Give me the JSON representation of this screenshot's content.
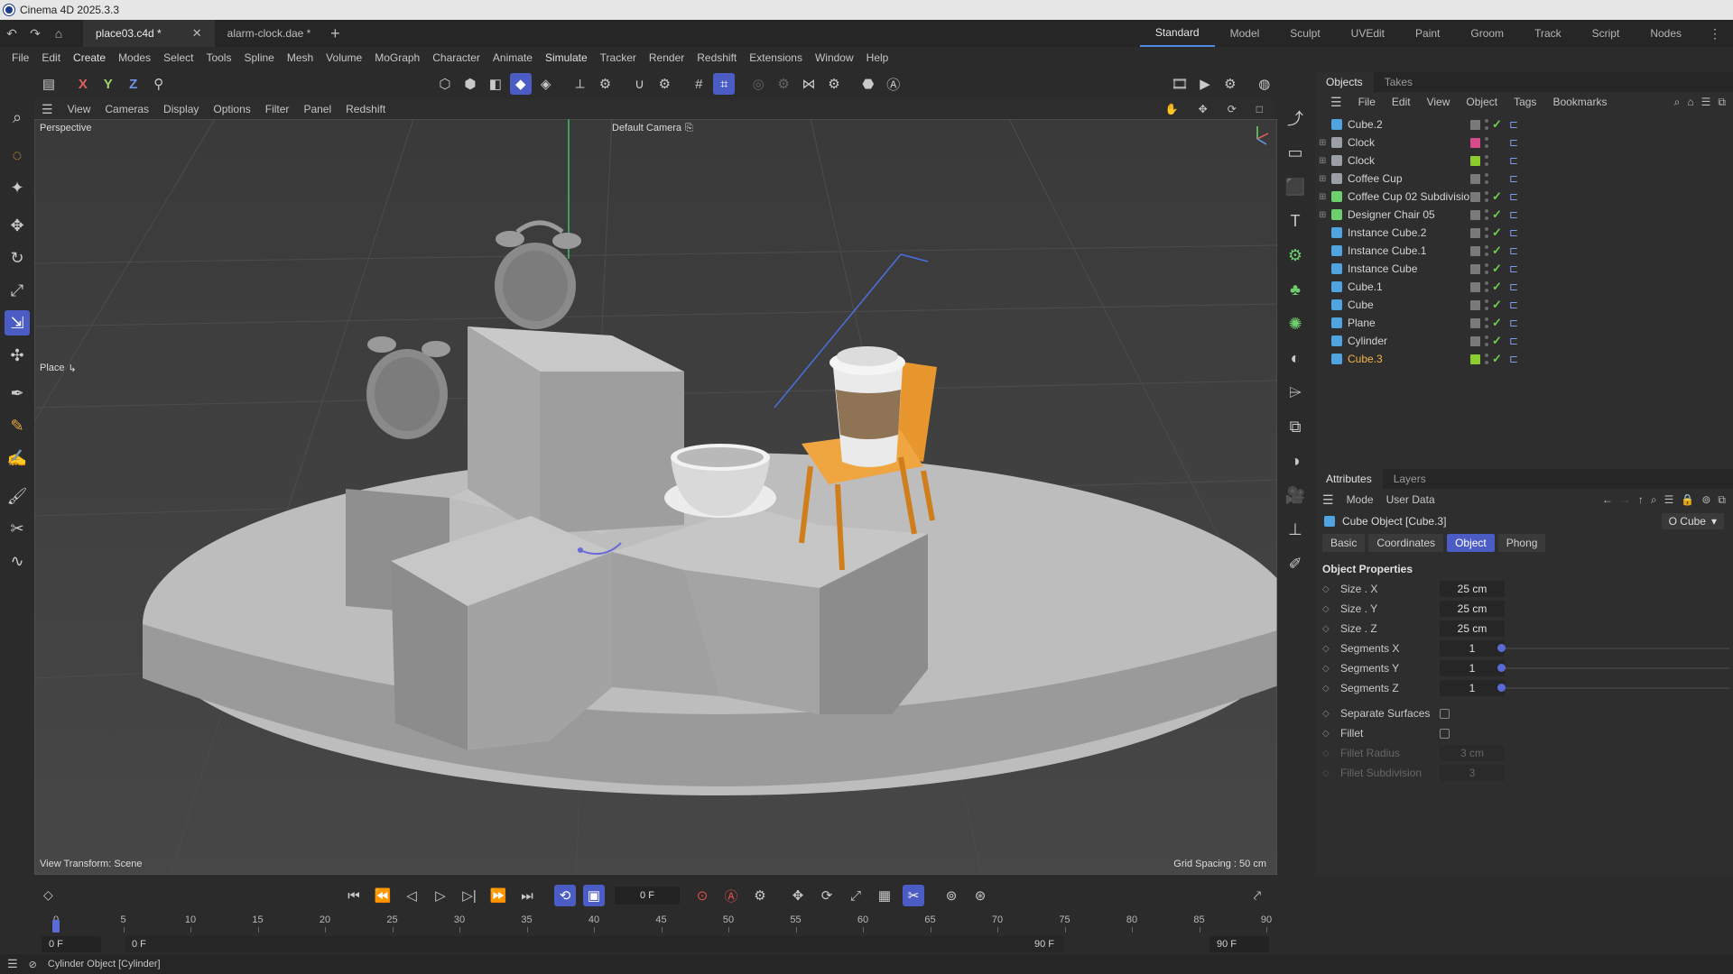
{
  "app": {
    "title": "Cinema 4D 2025.3.3"
  },
  "tabs": [
    {
      "label": "place03.c4d *",
      "active": true
    },
    {
      "label": "alarm-clock.dae *",
      "active": false
    }
  ],
  "layouts": [
    "Standard",
    "Model",
    "Sculpt",
    "UVEdit",
    "Paint",
    "Groom",
    "Track",
    "Script",
    "Nodes"
  ],
  "menus": [
    "File",
    "Edit",
    "Create",
    "Modes",
    "Select",
    "Tools",
    "Spline",
    "Mesh",
    "Volume",
    "MoGraph",
    "Character",
    "Animate",
    "Simulate",
    "Tracker",
    "Render",
    "Redshift",
    "Extensions",
    "Window",
    "Help"
  ],
  "toolbar": {
    "x": "X",
    "y": "Y",
    "z": "Z"
  },
  "viewport": {
    "menus": [
      "View",
      "Cameras",
      "Display",
      "Options",
      "Filter",
      "Panel",
      "Redshift"
    ],
    "label": "Perspective",
    "camera": "Default Camera",
    "tool_label": "Place",
    "view_transform": "View Transform: Scene",
    "grid_spacing": "Grid Spacing : 50 cm"
  },
  "objects_panel": {
    "tabs": [
      "Objects",
      "Takes"
    ],
    "menus": [
      "File",
      "Edit",
      "View",
      "Object",
      "Tags",
      "Bookmarks"
    ],
    "items": [
      {
        "name": "Cube.2",
        "swatch": "#7a7a7a",
        "check": true,
        "expand": false,
        "icon": "#4fa3e0",
        "selected": false
      },
      {
        "name": "Clock",
        "swatch": "#d84a8c",
        "check": false,
        "expand": true,
        "icon": "#9aa0a6",
        "selected": false
      },
      {
        "name": "Clock",
        "swatch": "#8ccc2e",
        "check": false,
        "expand": true,
        "icon": "#9aa0a6",
        "selected": false
      },
      {
        "name": "Coffee Cup",
        "swatch": "#7a7a7a",
        "check": false,
        "expand": true,
        "icon": "#9aa0a6",
        "selected": false
      },
      {
        "name": "Coffee Cup 02 Subdivision",
        "swatch": "#7a7a7a",
        "check": true,
        "expand": true,
        "icon": "#6fcf6f",
        "selected": false
      },
      {
        "name": "Designer Chair 05",
        "swatch": "#7a7a7a",
        "check": true,
        "expand": true,
        "icon": "#6fcf6f",
        "selected": false
      },
      {
        "name": "Instance Cube.2",
        "swatch": "#7a7a7a",
        "check": true,
        "expand": false,
        "icon": "#4fa3e0",
        "selected": false
      },
      {
        "name": "Instance Cube.1",
        "swatch": "#7a7a7a",
        "check": true,
        "expand": false,
        "icon": "#4fa3e0",
        "selected": false
      },
      {
        "name": "Instance Cube",
        "swatch": "#7a7a7a",
        "check": true,
        "expand": false,
        "icon": "#4fa3e0",
        "selected": false
      },
      {
        "name": "Cube.1",
        "swatch": "#7a7a7a",
        "check": true,
        "expand": false,
        "icon": "#4fa3e0",
        "selected": false
      },
      {
        "name": "Cube",
        "swatch": "#7a7a7a",
        "check": true,
        "expand": false,
        "icon": "#4fa3e0",
        "selected": false
      },
      {
        "name": "Plane",
        "swatch": "#7a7a7a",
        "check": true,
        "expand": false,
        "icon": "#4fa3e0",
        "selected": false
      },
      {
        "name": "Cylinder",
        "swatch": "#7a7a7a",
        "check": true,
        "expand": false,
        "icon": "#4fa3e0",
        "selected": false
      },
      {
        "name": "Cube.3",
        "swatch": "#8ccc2e",
        "check": true,
        "expand": false,
        "icon": "#4fa3e0",
        "selected": true
      }
    ]
  },
  "attributes_panel": {
    "tabs": [
      "Attributes",
      "Layers"
    ],
    "menus": [
      "Mode",
      "User Data"
    ],
    "object_title": "Cube Object [Cube.3]",
    "type_dropdown": "O Cube",
    "subtabs": [
      "Basic",
      "Coordinates",
      "Object",
      "Phong"
    ],
    "active_subtab": "Object",
    "section": "Object Properties",
    "props": [
      {
        "label": "Size . X",
        "value": "25 cm"
      },
      {
        "label": "Size . Y",
        "value": "25 cm"
      },
      {
        "label": "Size . Z",
        "value": "25 cm"
      },
      {
        "label": "Segments X",
        "value": "1"
      },
      {
        "label": "Segments Y",
        "value": "1"
      },
      {
        "label": "Segments Z",
        "value": "1"
      }
    ],
    "checks": [
      {
        "label": "Separate Surfaces"
      },
      {
        "label": "Fillet"
      }
    ],
    "dim_props": [
      {
        "label": "Fillet Radius",
        "value": "3 cm"
      },
      {
        "label": "Fillet Subdivision",
        "value": "3"
      }
    ]
  },
  "timeline": {
    "current_frame": "0 F",
    "ruler": [
      "0",
      "5",
      "10",
      "15",
      "20",
      "25",
      "30",
      "35",
      "40",
      "45",
      "50",
      "55",
      "60",
      "65",
      "70",
      "75",
      "80",
      "85",
      "90"
    ],
    "start": "0 F",
    "start2": "0 F",
    "end": "90 F",
    "end2": "90 F"
  },
  "status": {
    "text": "Cylinder Object [Cylinder]"
  },
  "colors": {
    "accent": "#4b5cc4",
    "selected_text": "#f0b445",
    "check": "#72d14d"
  }
}
